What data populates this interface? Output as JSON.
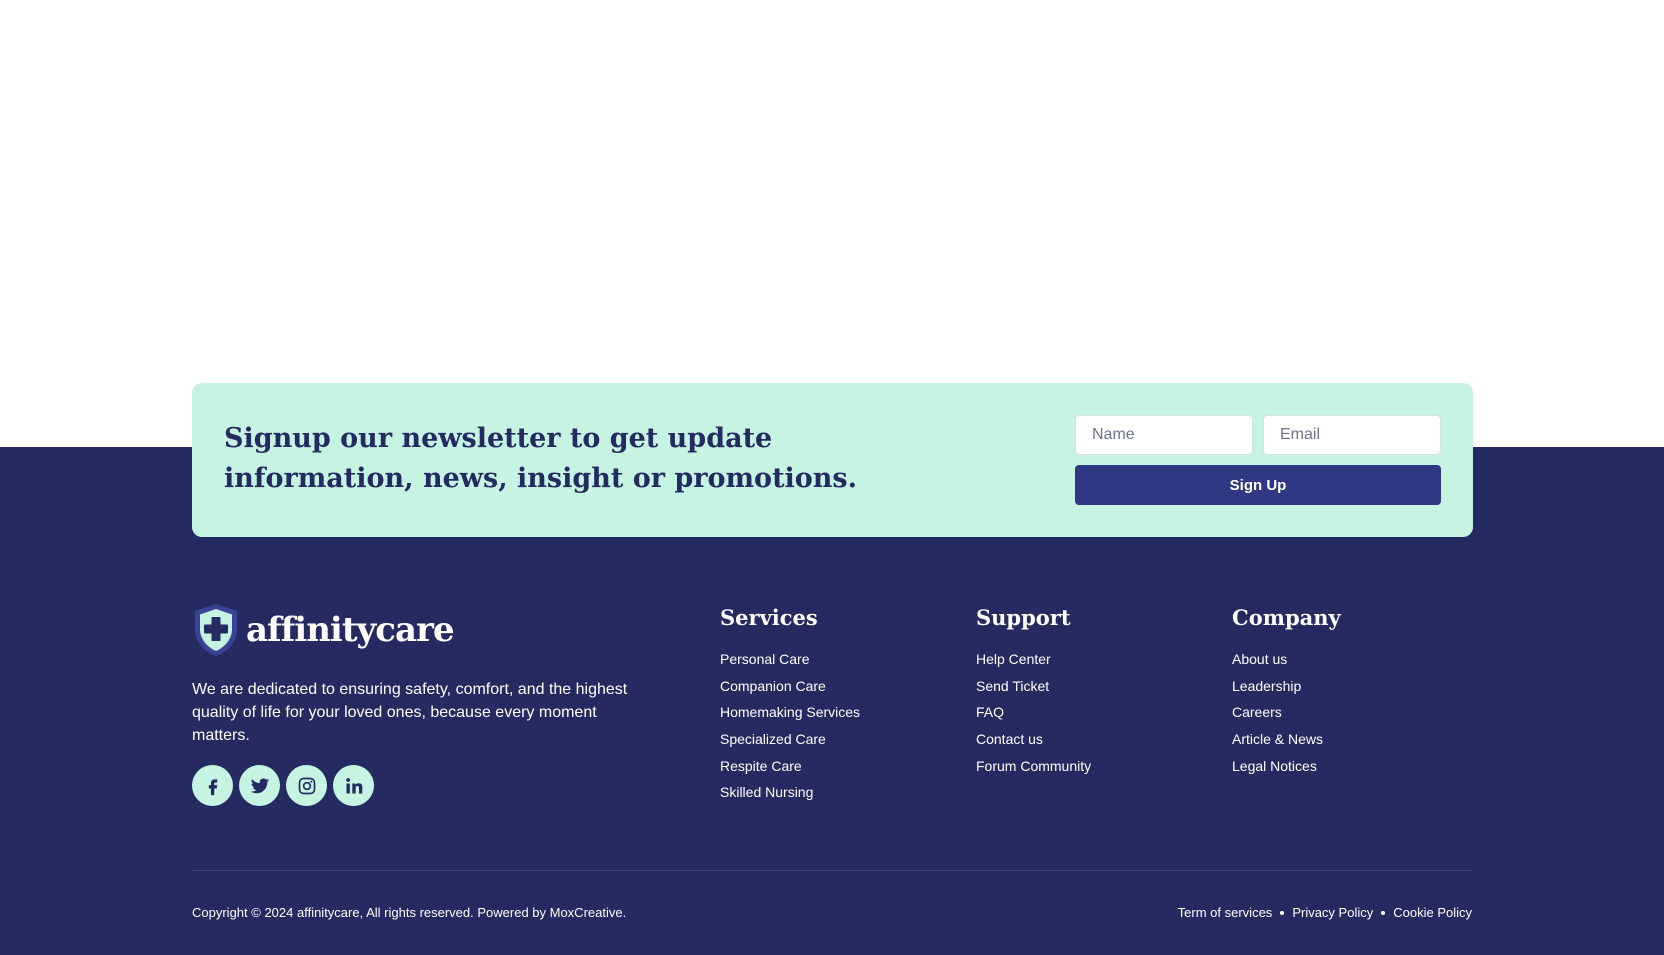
{
  "newsletter": {
    "heading": "Signup our newsletter to get update information, news, insight or promotions.",
    "name_placeholder": "Name",
    "email_placeholder": "Email",
    "button_label": "Sign Up"
  },
  "brand": {
    "name": "affinitycare",
    "tagline": "We are dedicated to ensuring safety, comfort, and the highest quality of life for your loved ones, because every moment matters."
  },
  "socials": [
    {
      "icon": "facebook-icon"
    },
    {
      "icon": "twitter-icon"
    },
    {
      "icon": "instagram-icon"
    },
    {
      "icon": "linkedin-icon"
    }
  ],
  "columns": {
    "services": {
      "title": "Services",
      "links": [
        "Personal Care",
        "Companion Care",
        "Homemaking Services",
        "Specialized Care",
        "Respite Care",
        "Skilled Nursing"
      ]
    },
    "support": {
      "title": "Support",
      "links": [
        "Help Center",
        "Send Ticket",
        "FAQ",
        "Contact us",
        "Forum Community"
      ]
    },
    "company": {
      "title": "Company",
      "links": [
        "About us",
        "Leadership",
        "Careers",
        "Article & News",
        "Legal Notices"
      ]
    }
  },
  "bottom": {
    "copyright": "Copyright © 2024 affinitycare, All rights reserved. Powered by MoxCreative.",
    "legal_links": [
      "Term of services",
      "Privacy Policy",
      "Cookie Policy"
    ]
  },
  "colors": {
    "footer_bg": "#252a60",
    "mint": "#c5f5e2",
    "button": "#303884",
    "white": "#ffffff"
  }
}
